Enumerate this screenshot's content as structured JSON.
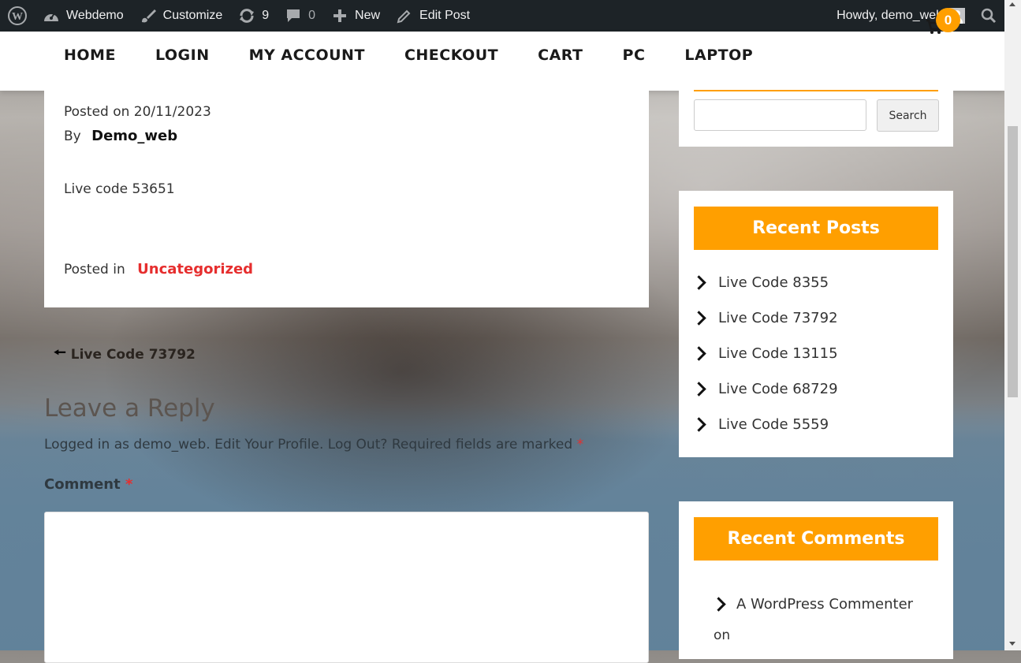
{
  "admin_bar": {
    "site_name": "Webdemo",
    "customize": "Customize",
    "updates": "9",
    "comments": "0",
    "new": "New",
    "edit_post": "Edit Post",
    "howdy": "Howdy, demo_web"
  },
  "nav": {
    "items": [
      "HOME",
      "LOGIN",
      "MY ACCOUNT",
      "CHECKOUT",
      "CART",
      "PC",
      "LAPTOP"
    ],
    "cart_count": "0"
  },
  "article": {
    "posted_on": "Posted on 20/11/2023",
    "by_label": "By",
    "author": "Demo_web",
    "content": "Live code 53651",
    "posted_in_label": "Posted in",
    "category": "Uncategorized"
  },
  "post_nav": {
    "prev": "Live Code 73792"
  },
  "reply": {
    "title": "Leave a Reply",
    "logged_in_as": "Logged in as demo_web.",
    "edit_profile": "Edit Your Profile.",
    "log_out": "Log Out?",
    "required_text": "Required fields are marked",
    "required_mark": "*",
    "comment_label": "Comment"
  },
  "sidebar": {
    "search_button": "Search",
    "recent_posts_title": "Recent Posts",
    "recent_posts": [
      "Live Code 8355",
      "Live Code 73792",
      "Live Code 13115",
      "Live Code 68729",
      "Live Code 5559"
    ],
    "recent_comments_title": "Recent Comments",
    "recent_comment_author": "A WordPress Commenter",
    "recent_comment_on": "on"
  },
  "colors": {
    "accent": "#ff9f00",
    "link_red": "#e62e2e",
    "admin_bar": "#1d2327"
  },
  "icons": [
    "wordpress-icon",
    "customize-brush-icon",
    "updates-icon",
    "comment-bubble-icon",
    "plus-icon",
    "pencil-icon",
    "search-icon",
    "cart-icon",
    "arrow-left-icon",
    "chevron-right-icon"
  ]
}
